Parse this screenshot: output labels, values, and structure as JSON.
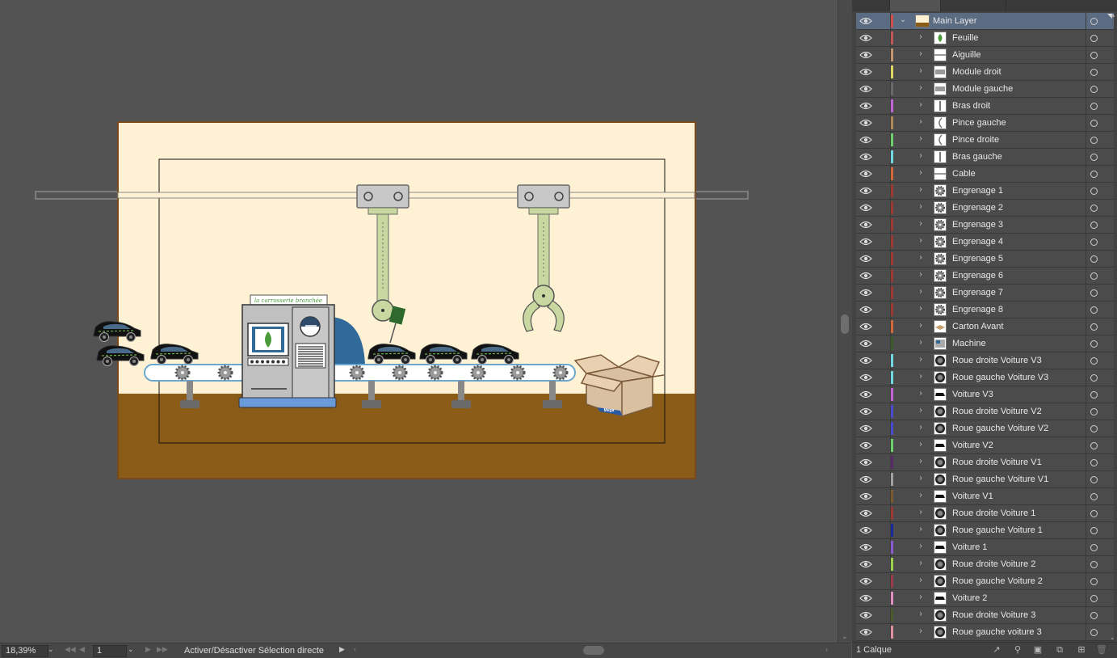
{
  "document": {
    "zoom": "18,39%",
    "page": "1",
    "status_text": "Activer/Désactiver Sélection directe"
  },
  "canvas": {
    "machine_banner": "la carrosserie branchée",
    "box_logo": "Mega"
  },
  "layers_panel": {
    "footer_count": "1 Calque",
    "main_layer": {
      "name": "Main Layer",
      "color": "#d05050"
    },
    "layers": [
      {
        "name": "Feuille",
        "color": "#c25757",
        "thumb": "leaf"
      },
      {
        "name": "Aiguille",
        "color": "#c4956a",
        "thumb": "line"
      },
      {
        "name": "Module droit",
        "color": "#e0d860",
        "thumb": "module"
      },
      {
        "name": "Module gauche",
        "color": "#6a6a6a",
        "thumb": "module"
      },
      {
        "name": "Bras droit",
        "color": "#c064d6",
        "thumb": "bar"
      },
      {
        "name": "Pince gauche",
        "color": "#b08a5a",
        "thumb": "claw"
      },
      {
        "name": "Pince droite",
        "color": "#6ed068",
        "thumb": "claw"
      },
      {
        "name": "Bras gauche",
        "color": "#6fd8e0",
        "thumb": "bar"
      },
      {
        "name": "Cable",
        "color": "#d0683a",
        "thumb": "line"
      },
      {
        "name": "Engrenage 1",
        "color": "#9a3a32",
        "thumb": "gear"
      },
      {
        "name": "Engrenage 2",
        "color": "#9a3a32",
        "thumb": "gear"
      },
      {
        "name": "Engrenage 3",
        "color": "#9a3a32",
        "thumb": "gear"
      },
      {
        "name": "Engrenage 4",
        "color": "#9a3a32",
        "thumb": "gear"
      },
      {
        "name": "Engrenage 5",
        "color": "#9a3a32",
        "thumb": "gear"
      },
      {
        "name": "Engrenage 6",
        "color": "#9a3a32",
        "thumb": "gear"
      },
      {
        "name": "Engrenage 7",
        "color": "#9a3a32",
        "thumb": "gear"
      },
      {
        "name": "Engrenage 8",
        "color": "#9a3a32",
        "thumb": "gear"
      },
      {
        "name": "Carton Avant",
        "color": "#d0683a",
        "thumb": "box"
      },
      {
        "name": "Machine",
        "color": "#3a5a2a",
        "thumb": "machine"
      },
      {
        "name": "Roue droite Voiture V3",
        "color": "#6fd8e0",
        "thumb": "wheel"
      },
      {
        "name": "Roue gauche Voiture V3",
        "color": "#6fd8e0",
        "thumb": "wheel"
      },
      {
        "name": "Voiture V3",
        "color": "#c064d6",
        "thumb": "car"
      },
      {
        "name": "Roue droite Voiture V2",
        "color": "#4a4ad0",
        "thumb": "wheel"
      },
      {
        "name": "Roue gauche Voiture V2",
        "color": "#4a4ad0",
        "thumb": "wheel"
      },
      {
        "name": "Voiture V2",
        "color": "#6ed068",
        "thumb": "car"
      },
      {
        "name": "Roue droite Voiture V1",
        "color": "#5a2a6a",
        "thumb": "wheel"
      },
      {
        "name": "Roue gauche Voiture V1",
        "color": "#a0a0a0",
        "thumb": "wheel"
      },
      {
        "name": "Voiture V1",
        "color": "#7a5a2a",
        "thumb": "car"
      },
      {
        "name": "Roue droite Voiture 1",
        "color": "#9a3a32",
        "thumb": "wheel"
      },
      {
        "name": "Roue gauche Voiture 1",
        "color": "#1a2a9a",
        "thumb": "wheel"
      },
      {
        "name": "Voiture 1",
        "color": "#8a5ad0",
        "thumb": "car"
      },
      {
        "name": "Roue droite Voiture 2",
        "color": "#9ad04a",
        "thumb": "wheel"
      },
      {
        "name": "Roue gauche Voiture 2",
        "color": "#9a3a4a",
        "thumb": "wheel"
      },
      {
        "name": "Voiture 2",
        "color": "#e090c0",
        "thumb": "car"
      },
      {
        "name": "Roue droite Voiture 3",
        "color": "#4a5a2a",
        "thumb": "wheel"
      },
      {
        "name": "Roue gauche voiture 3",
        "color": "#e090a0",
        "thumb": "wheel"
      }
    ]
  }
}
